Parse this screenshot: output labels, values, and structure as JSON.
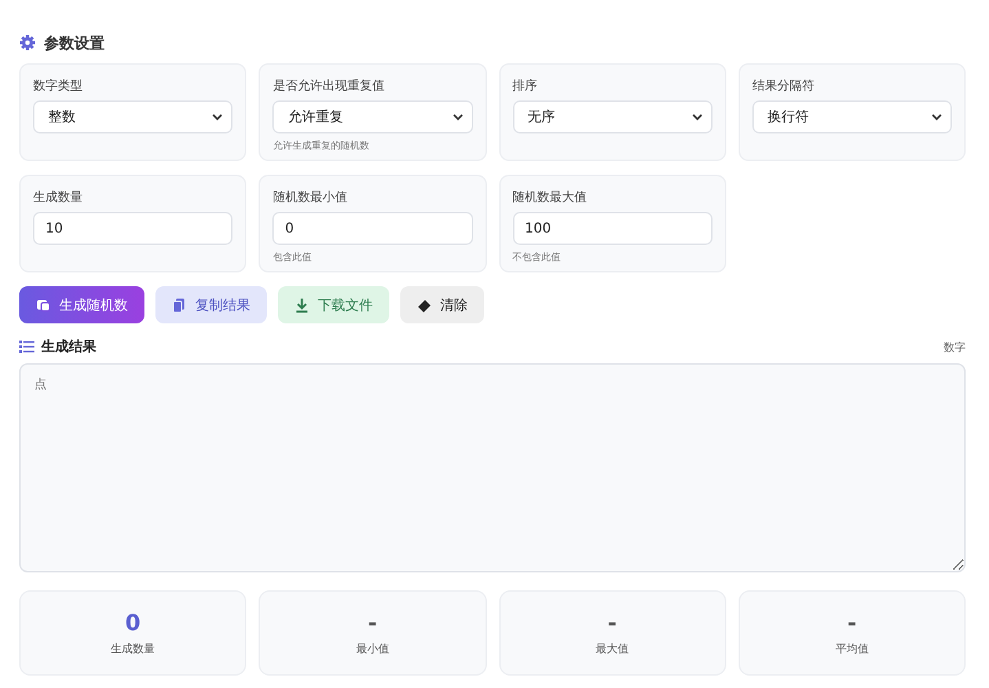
{
  "settings": {
    "title": "参数设置",
    "fields": [
      {
        "kind": "select",
        "label": "数字类型",
        "value": "整数"
      },
      {
        "kind": "select",
        "label": "是否允许出现重复值",
        "value": "允许重复",
        "hint": "允许生成重复的随机数"
      },
      {
        "kind": "select",
        "label": "排序",
        "value": "无序"
      },
      {
        "kind": "select",
        "label": "结果分隔符",
        "value": "换行符"
      },
      {
        "kind": "input",
        "label": "生成数量",
        "value": "10"
      },
      {
        "kind": "input",
        "label": "随机数最小值",
        "value": "0",
        "hint": "包含此值"
      },
      {
        "kind": "input",
        "label": "随机数最大值",
        "value": "100",
        "hint": "不包含此值"
      }
    ]
  },
  "actions": [
    {
      "kind": "primary",
      "label": "生成随机数"
    },
    {
      "kind": "copy",
      "label": "复制结果"
    },
    {
      "kind": "download",
      "label": "下载文件"
    },
    {
      "kind": "clear",
      "label": "清除"
    }
  ],
  "results": {
    "title": "生成结果",
    "count": "数字",
    "placeholder": "点"
  },
  "stats": [
    {
      "value": "0",
      "label": "生成数量",
      "highlight": true
    },
    {
      "value": "-",
      "label": "最小值",
      "highlight": false
    },
    {
      "value": "-",
      "label": "最大值",
      "highlight": false
    },
    {
      "value": "-",
      "label": "平均值",
      "highlight": false
    }
  ]
}
